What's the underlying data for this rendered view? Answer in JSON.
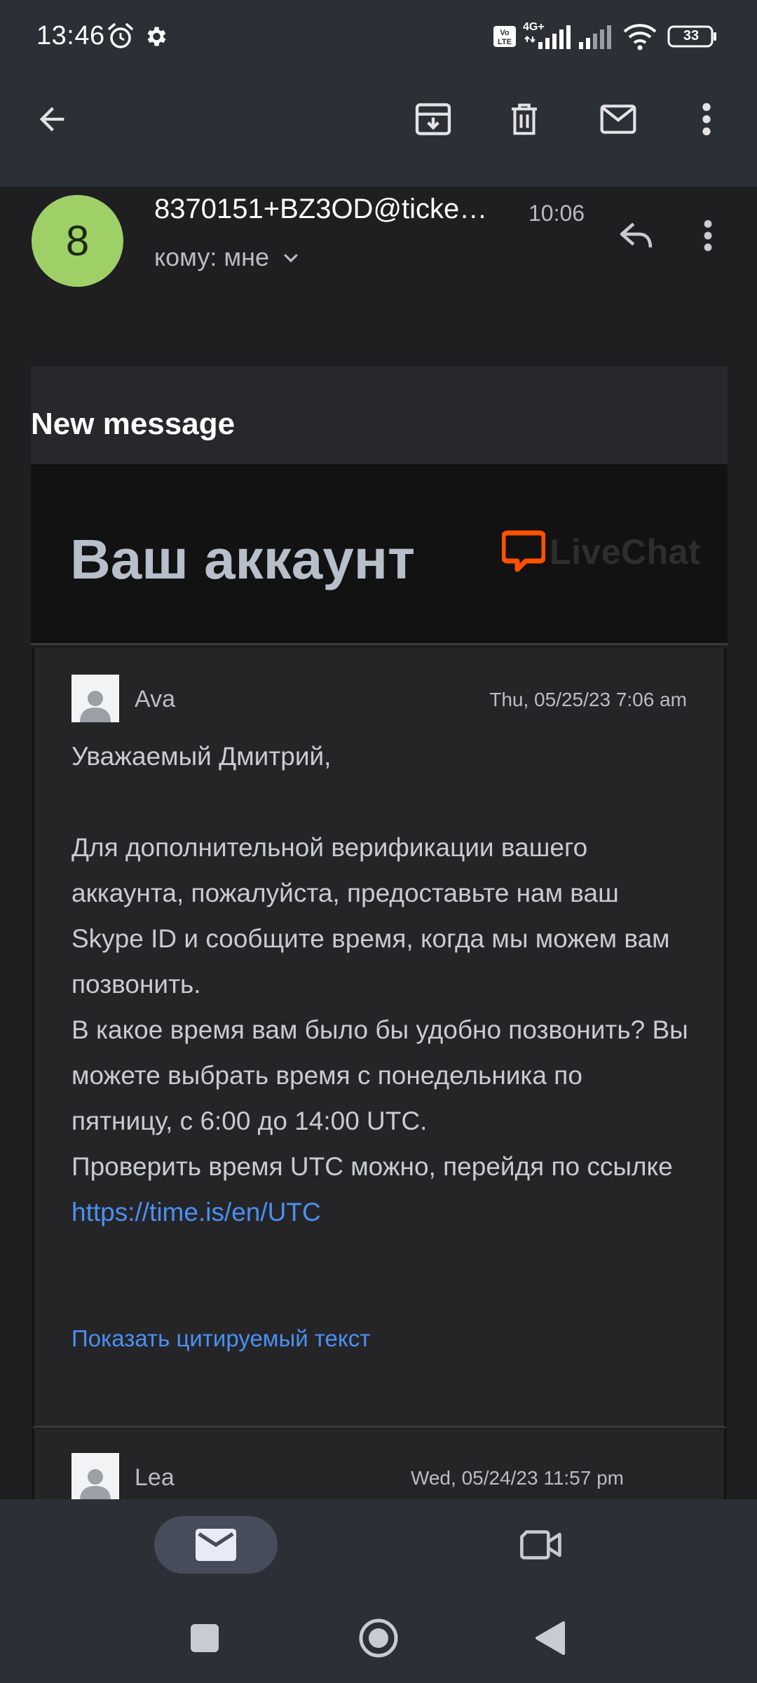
{
  "status_bar": {
    "time": "13:46",
    "network": "4G+",
    "battery": "33"
  },
  "app_bar": {
    "icons": [
      "arrow-back-icon",
      "archive-icon",
      "trash-icon",
      "mail-icon",
      "more-vert-icon"
    ]
  },
  "email": {
    "sender_initial": "8",
    "sender_address": "8370151+BZ3OD@ticke…",
    "time": "10:06",
    "recipient": "кому: мне",
    "header_title": "New message",
    "banner_title": "Ваш аккаунт",
    "logo_text": "LiveChat"
  },
  "thread": [
    {
      "author": "Ava",
      "date": "Thu, 05/25/23 7:06 am",
      "greeting": "Уважаемый Дмитрий,",
      "para1": "Для дополнительной верификации вашего аккаунта, пожалуйста, предоставьте нам ваш Skype ID и сообщите время, когда мы можем вам позвонить.",
      "para2": "В какое время вам было бы удобно позвонить? Вы можете выбрать время с понедельника по пятницу, с 6:00 до 14:00 UTC.",
      "para3_prefix": "Проверить время UTC можно, перейдя по ссылке ",
      "link": "https://time.is/en/UTC",
      "show_quoted": "Показать цитируемый текст"
    },
    {
      "author": "Lea",
      "date": "Wed, 05/24/23 11:57 pm"
    }
  ],
  "colors": {
    "toolbar_bg": "#2b2f36",
    "page_bg": "#1f1f22",
    "avatar_green": "#9fd067",
    "link_blue": "#4a90f2",
    "livechat_orange": "#ff5100"
  }
}
